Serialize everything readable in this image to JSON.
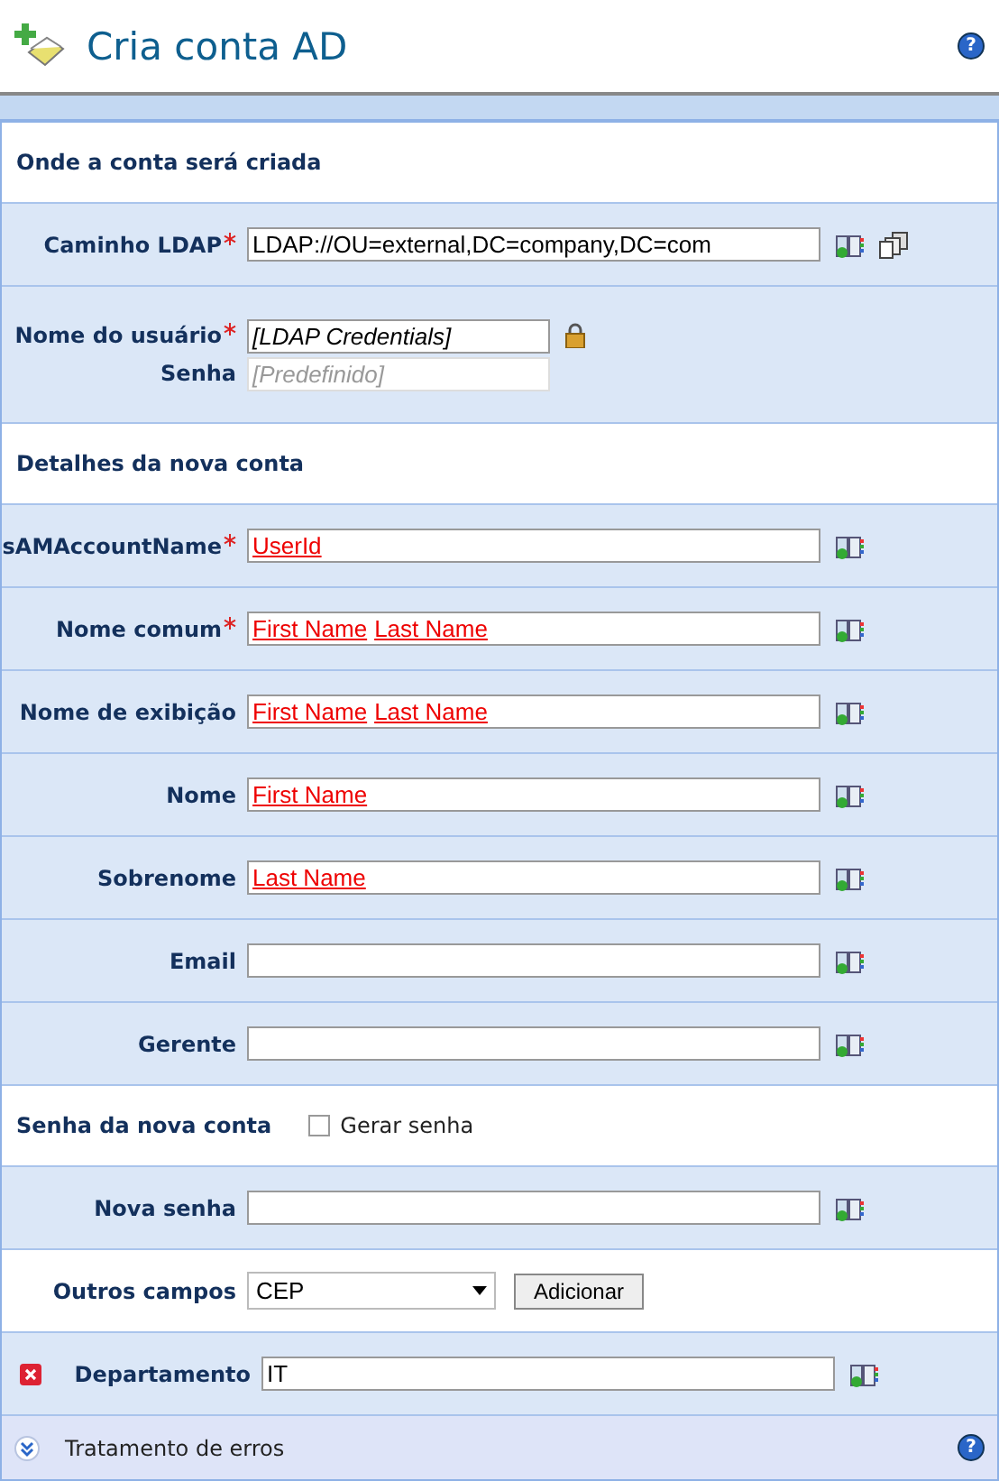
{
  "title": "Cria conta AD",
  "help": "?",
  "rows": [
    {
      "kind": "section",
      "label": "Onde a conta será criada"
    },
    {
      "kind": "field",
      "label": "Caminho LDAP",
      "required": true,
      "value": "LDAP://OU=external,DC=company,DC=com",
      "icons": [
        {
          "kind": "book"
        },
        {
          "kind": "servers"
        }
      ]
    },
    {
      "kind": "credentials",
      "label": "Nome do usuário",
      "required": true,
      "value": "[LDAP Credentials]",
      "icons": [
        {
          "kind": "lock"
        }
      ],
      "label2": "Senha",
      "placeholder": "[Predefinido]"
    },
    {
      "kind": "section",
      "label": "Detalhes da nova conta"
    },
    {
      "kind": "field",
      "label": "sAMAccountName",
      "required": true,
      "tokens": [
        "UserId"
      ],
      "icons": [
        {
          "kind": "book"
        }
      ]
    },
    {
      "kind": "field",
      "label": "Nome comum",
      "required": true,
      "tokens": [
        "First Name",
        "Last Name"
      ],
      "icons": [
        {
          "kind": "book"
        }
      ]
    },
    {
      "kind": "field",
      "label": "Nome de exibição",
      "required": false,
      "tokens": [
        "First Name",
        "Last Name"
      ],
      "icons": [
        {
          "kind": "book"
        }
      ]
    },
    {
      "kind": "field",
      "label": "Nome",
      "required": false,
      "tokens": [
        "First Name"
      ],
      "icons": [
        {
          "kind": "book"
        }
      ]
    },
    {
      "kind": "field",
      "label": "Sobrenome",
      "required": false,
      "tokens": [
        "Last Name"
      ],
      "icons": [
        {
          "kind": "book"
        }
      ]
    },
    {
      "kind": "field",
      "label": "Email",
      "required": false,
      "icons": [
        {
          "kind": "book"
        }
      ]
    },
    {
      "kind": "field",
      "label": "Gerente",
      "required": false,
      "icons": [
        {
          "kind": "book"
        }
      ]
    },
    {
      "kind": "checkbox-section",
      "label": "Senha da nova conta",
      "option": "Gerar senha",
      "checked": false
    },
    {
      "kind": "field",
      "label": "Nova senha",
      "required": false,
      "icons": [
        {
          "kind": "book"
        }
      ]
    },
    {
      "kind": "select",
      "label": "Outros campos",
      "value": "CEP",
      "button": "Adicionar"
    },
    {
      "kind": "removable",
      "label": "Departamento",
      "value": "IT",
      "icons": [
        {
          "kind": "book"
        }
      ]
    }
  ],
  "footer": {
    "label": "Tratamento de erros",
    "expanded": false,
    "help": "?"
  }
}
